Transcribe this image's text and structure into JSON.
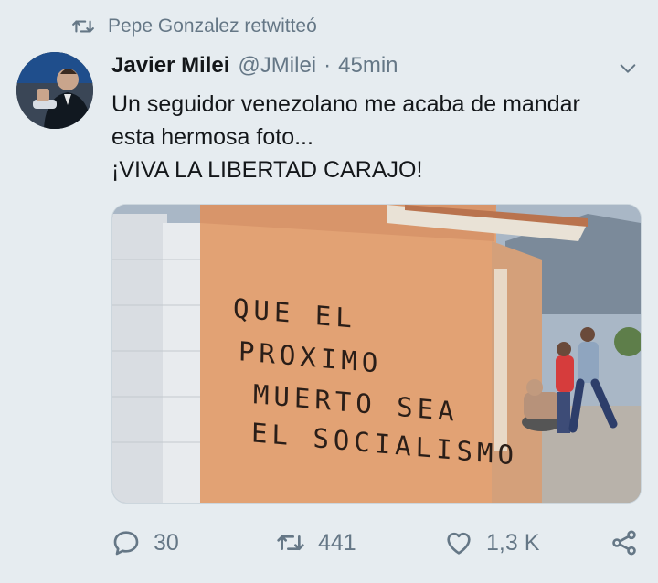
{
  "retweet": {
    "icon": "retweet-icon",
    "text": "Pepe Gonzalez retwitteó"
  },
  "tweet": {
    "avatar_icon": "avatar-photo",
    "author_name": "Javier Milei",
    "handle": "@JMilei",
    "separator": "·",
    "time": "45min",
    "menu_icon": "chevron-down-icon",
    "text_lines": [
      "Un seguidor venezolano me acaba de mandar",
      "esta hermosa foto...",
      "¡VIVA LA LIBERTAD CARAJO!"
    ],
    "media": {
      "graffiti_lines": [
        "QUE EL",
        "PROXIMO",
        "MUERTO SEA",
        "EL SOCIALISMO"
      ]
    }
  },
  "actions": {
    "reply": {
      "icon": "reply-icon",
      "count": "30"
    },
    "retweet": {
      "icon": "retweet-icon",
      "count": "441"
    },
    "like": {
      "icon": "heart-icon",
      "count": "1,3 K"
    },
    "share": {
      "icon": "share-icon"
    }
  },
  "colors": {
    "background": "#e6ecf0",
    "text": "#14171a",
    "secondary": "#657786"
  }
}
